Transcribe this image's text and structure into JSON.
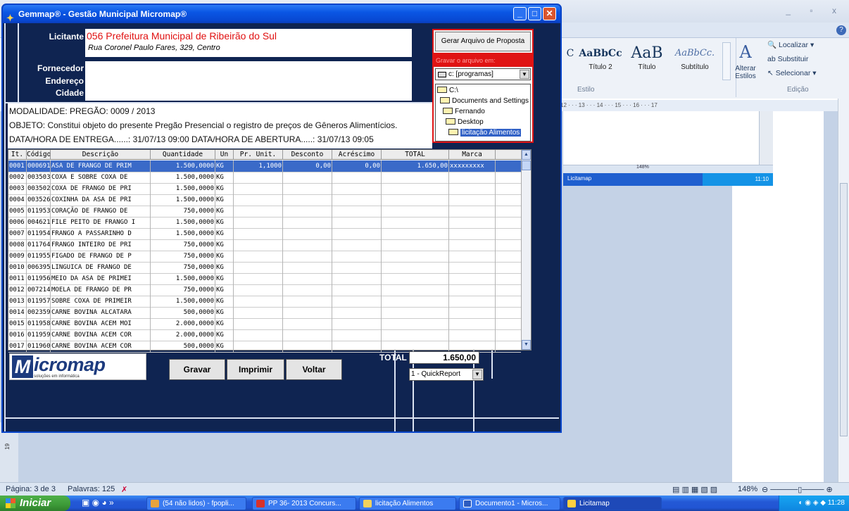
{
  "gemmap": {
    "title": "Gemmap® - Gestão Municipal Micromap®",
    "licitante_label": "Licitante",
    "licitante_name": "056 Prefeitura Municipal de Ribeirão do Sul",
    "licitante_address": "Rua Coronel Paulo Fares, 329, Centro",
    "fornecedor_label": "Fornecedor",
    "endereco_label": "Endereço",
    "cidade_label": "Cidade",
    "modalidade": "MODALIDADE: PREGÃO: 0009 / 2013",
    "objeto": "OBJETO: Constitui objeto do presente Pregão Presencial o registro de preços de Gêneros Alimentícios.",
    "datas": "DATA/HORA DE ENTREGA......: 31/07/13 09:00  DATA/HORA DE ABERTURA.....: 31/07/13 09:05",
    "gerar_button": "Gerar Arquivo de Proposta",
    "gravar_label": "Gravar o arquivo em:",
    "drive": "c: [programas]",
    "folders": [
      "C:\\",
      "Documents and Settings",
      "Fernando",
      "Desktop",
      "licitação Alimentos"
    ],
    "grid_headers": [
      "It.",
      "Código",
      "Descrição",
      "Quantidade",
      "Un",
      "Pr. Unit.",
      "Desconto",
      "Acréscimo",
      "TOTAL",
      "Marca"
    ],
    "rows": [
      [
        "0001",
        "000691",
        "ASA DE FRANGO DE PRIM",
        "1.500,0000",
        "KG",
        "1,1000",
        "0,00",
        "0,00",
        "1.650,00",
        "xxxxxxxxx"
      ],
      [
        "0002",
        "003503",
        "COXA E SOBRE COXA DE",
        "1.500,0000",
        "KG",
        "",
        "",
        "",
        "",
        ""
      ],
      [
        "0003",
        "003502",
        "COXA DE FRANGO DE PRI",
        "1.500,0000",
        "KG",
        "",
        "",
        "",
        "",
        ""
      ],
      [
        "0004",
        "003526",
        "COXINHA DA ASA DE PRI",
        "1.500,0000",
        "KG",
        "",
        "",
        "",
        "",
        ""
      ],
      [
        "0005",
        "011953",
        "CORAÇÃO DE FRANGO DE",
        "750,0000",
        "KG",
        "",
        "",
        "",
        "",
        ""
      ],
      [
        "0006",
        "004621",
        "FILE PEITO DE FRANGO I",
        "1.500,0000",
        "KG",
        "",
        "",
        "",
        "",
        ""
      ],
      [
        "0007",
        "011954",
        "FRANGO A PASSARINHO D",
        "1.500,0000",
        "KG",
        "",
        "",
        "",
        "",
        ""
      ],
      [
        "0008",
        "011764",
        "FRANGO INTEIRO DE PRI",
        "750,0000",
        "KG",
        "",
        "",
        "",
        "",
        ""
      ],
      [
        "0009",
        "011955",
        "FIGADO DE FRANGO DE P",
        "750,0000",
        "KG",
        "",
        "",
        "",
        "",
        ""
      ],
      [
        "0010",
        "006395",
        "LINGUICA DE FRANGO DE",
        "750,0000",
        "KG",
        "",
        "",
        "",
        "",
        ""
      ],
      [
        "0011",
        "011956",
        "MEIO DA ASA DE PRIMEI",
        "1.500,0000",
        "KG",
        "",
        "",
        "",
        "",
        ""
      ],
      [
        "0012",
        "007214",
        "MOELA DE FRANGO DE PR",
        "750,0000",
        "KG",
        "",
        "",
        "",
        "",
        ""
      ],
      [
        "0013",
        "011957",
        "SOBRE COXA DE PRIMEIR",
        "1.500,0000",
        "KG",
        "",
        "",
        "",
        "",
        ""
      ],
      [
        "0014",
        "002359",
        "CARNE BOVINA ALCATARA",
        "500,0000",
        "KG",
        "",
        "",
        "",
        "",
        ""
      ],
      [
        "0015",
        "011958",
        "CARNE BOVINA ACEM MOI",
        "2.000,0000",
        "KG",
        "",
        "",
        "",
        "",
        ""
      ],
      [
        "0016",
        "011959",
        "CARNE BOVINA ACEM COR",
        "2.000,0000",
        "KG",
        "",
        "",
        "",
        "",
        ""
      ],
      [
        "0017",
        "011960",
        "CARNE BOVINA ACEM COR",
        "500,0000",
        "KG",
        "",
        "",
        "",
        "",
        ""
      ]
    ],
    "logo_text": "icromap",
    "logo_letter": "M",
    "logo_sub": "soluções em informática",
    "btn_gravar": "Gravar",
    "btn_imprimir": "Imprimir",
    "btn_voltar": "Voltar",
    "total_label": "TOTAL",
    "total_value": "1.650,00",
    "report": "1 - QuickReport"
  },
  "word": {
    "style_titulo2_sample": "AaBbCc",
    "style_titulo2": "Título 2",
    "style_titulo_sample": "AaB",
    "style_titulo": "Título",
    "style_subtitulo_sample": "AaBbCc.",
    "style_subtitulo": "Subtítulo",
    "style_cut_sample": "C",
    "alterar": "Alterar Estilos",
    "estilo_label": "Estilo",
    "localizar": "Localizar",
    "substituir": "Substituir",
    "selecionar": "Selecionar",
    "edicao_label": "Edição",
    "ruler": "12 · · · 13 · · · 14 · · · 15 · · · 16 · · · 17",
    "status_page": "Página: 3 de 3",
    "status_words": "Palavras: 125",
    "zoom": "148%",
    "emb_task": "Licitamap",
    "emb_time": "11:10",
    "ruler_left": "19"
  },
  "taskbar": {
    "start": "Iniciar",
    "tasks": [
      "(54 não lidos) - fpopli...",
      "PP 36- 2013 Concurs...",
      "licitação Alimentos",
      "Documento1 - Micros...",
      "Licitamap"
    ],
    "time": "11:28"
  }
}
